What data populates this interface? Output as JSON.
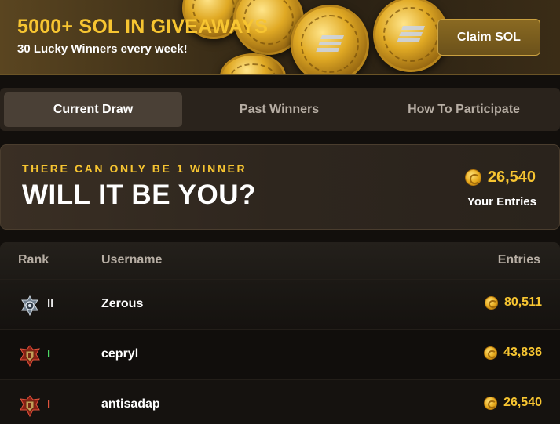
{
  "banner": {
    "title": "5000+ SOL IN GIVEAWAYS",
    "subtitle": "30 Lucky Winners every week!",
    "claim_label": "Claim SOL"
  },
  "tabs": [
    {
      "label": "Current Draw",
      "active": true
    },
    {
      "label": "Past Winners",
      "active": false
    },
    {
      "label": "How To Participate",
      "active": false
    }
  ],
  "draw": {
    "kicker": "THERE CAN ONLY BE 1 WINNER",
    "headline": "WILL IT BE YOU?",
    "your_entries_value": "26,540",
    "your_entries_label": "Your Entries"
  },
  "table": {
    "headers": {
      "rank": "Rank",
      "username": "Username",
      "entries": "Entries"
    },
    "rows": [
      {
        "rank": "II",
        "rank_color": "#e8e8e8",
        "badge": "silver-shield-icon",
        "username": "Zerous",
        "entries": "80,511"
      },
      {
        "rank": "I",
        "rank_color": "#4cd964",
        "badge": "red-crest-icon",
        "username": "cepryl",
        "entries": "43,836"
      },
      {
        "rank": "I",
        "rank_color": "#e0533c",
        "badge": "red-crest-icon",
        "username": "antisadap",
        "entries": "26,540"
      }
    ]
  },
  "colors": {
    "accent": "#f7c531",
    "background": "#120f0c"
  }
}
